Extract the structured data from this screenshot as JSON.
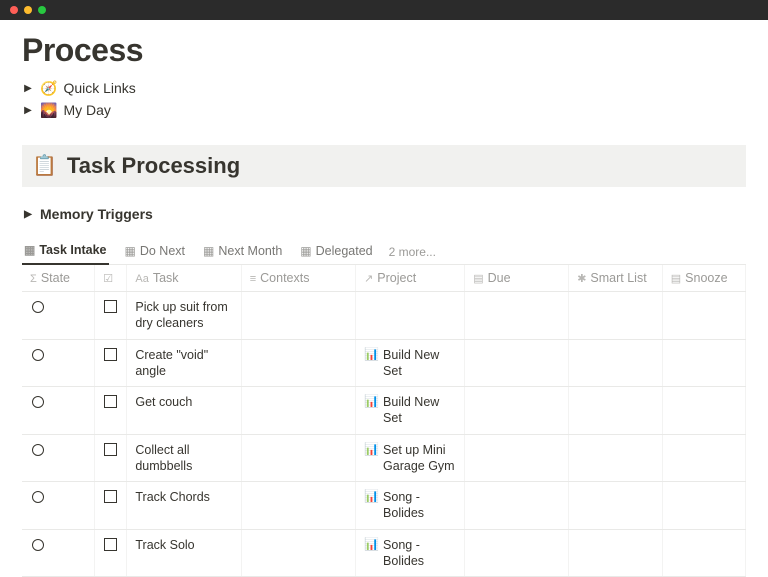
{
  "page": {
    "title": "Process"
  },
  "toggles": [
    {
      "icon": "🧭",
      "label": "Quick Links"
    },
    {
      "icon": "🌄",
      "label": "My Day"
    }
  ],
  "callout": {
    "icon": "📋",
    "title": "Task Processing"
  },
  "memory_toggle": {
    "label": "Memory Triggers"
  },
  "views": {
    "tabs": [
      {
        "label": "Task Intake",
        "active": true
      },
      {
        "label": "Do Next",
        "active": false
      },
      {
        "label": "Next Month",
        "active": false
      },
      {
        "label": "Delegated",
        "active": false
      }
    ],
    "more": "2 more..."
  },
  "columns": {
    "state": "State",
    "task": "Task",
    "contexts": "Contexts",
    "project": "Project",
    "due": "Due",
    "smart": "Smart List",
    "snooze": "Snooze"
  },
  "rows": [
    {
      "task": "Pick up suit from dry cleaners",
      "project": ""
    },
    {
      "task": "Create \"void\" angle",
      "project": "Build New Set"
    },
    {
      "task": "Get couch",
      "project": "Build New Set"
    },
    {
      "task": "Collect all dumbbells",
      "project": "Set up Mini Garage Gym"
    },
    {
      "task": "Track Chords",
      "project": "Song - Bolides"
    },
    {
      "task": "Track Solo",
      "project": "Song - Bolides"
    }
  ],
  "project_icon": "📊"
}
